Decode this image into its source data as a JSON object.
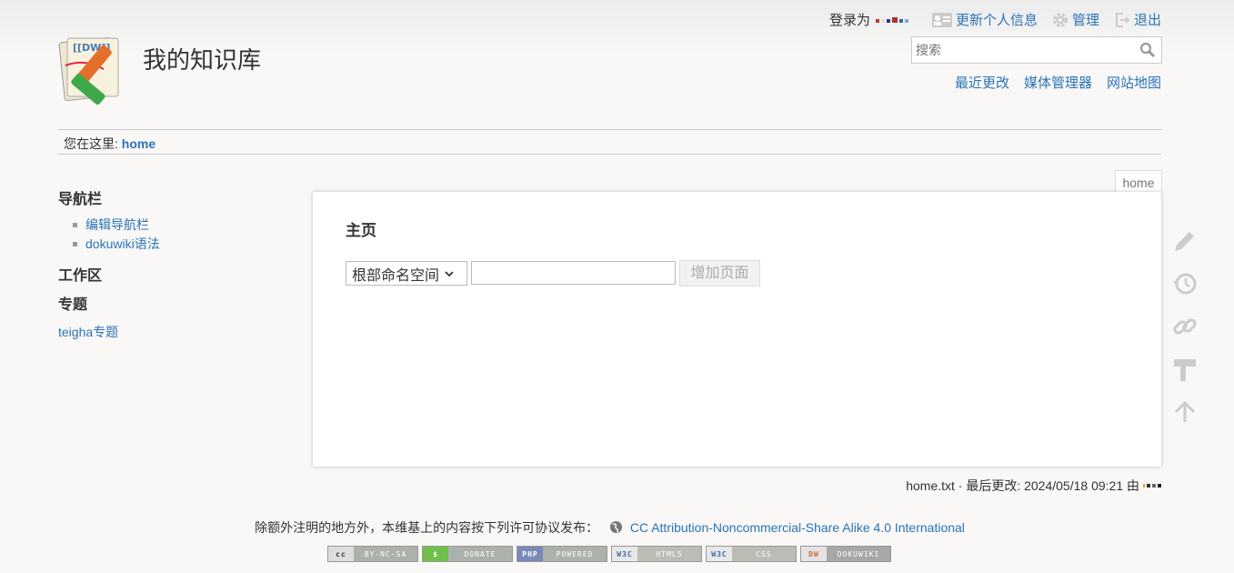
{
  "header": {
    "site_title": "我的知识库",
    "logged_in_label": "登录为",
    "user_menu": [
      {
        "label": "更新个人信息",
        "icon": "user-card-icon"
      },
      {
        "label": "管理",
        "icon": "gear-icon"
      },
      {
        "label": "退出",
        "icon": "logout-icon"
      }
    ],
    "search": {
      "placeholder": "搜索",
      "value": ""
    },
    "site_tools": [
      "最近更改",
      "媒体管理器",
      "网站地图"
    ]
  },
  "breadcrumb": {
    "label": "您在这里:",
    "current": "home"
  },
  "sidebar": {
    "nav_title": "导航栏",
    "nav_items": [
      "编辑导航栏",
      "dokuwiki语法"
    ],
    "workspace_title": "工作区",
    "topic_title": "专题",
    "topic_link": "teigha专题"
  },
  "page": {
    "tab": "home",
    "title": "主页",
    "namespace_select": "根部命名空间",
    "add_button": "增加页面"
  },
  "page_tools": [
    "pencil-icon",
    "history-icon",
    "link-icon",
    "paint-roller-icon",
    "arrow-up-icon"
  ],
  "doc_info": {
    "text": "home.txt · 最后更改: 2024/05/18 09:21 由"
  },
  "footer": {
    "license_text": "除额外注明的地方外，本维基上的内容按下列许可协议发布：",
    "license_link": "CC Attribution-Noncommercial-Share Alike 4.0 International",
    "badges": [
      {
        "left": "cc",
        "right": "BY-NC-SA",
        "color": "#aab2ab"
      },
      {
        "left": "$",
        "right": "DONATE",
        "color": "#6fbf4a"
      },
      {
        "left": "PHP",
        "right": "POWERED",
        "color": "#7b88b8"
      },
      {
        "left": "W3C",
        "right": "HTML5",
        "color": "#b9bdb6"
      },
      {
        "left": "W3C",
        "right": "CSS",
        "color": "#b9bdb6"
      },
      {
        "left": "DW",
        "right": "DOKUWIKI",
        "color": "#a7a7a7"
      }
    ]
  },
  "colors": {
    "link": "#2b73b7",
    "background": "#f9f8f7"
  }
}
